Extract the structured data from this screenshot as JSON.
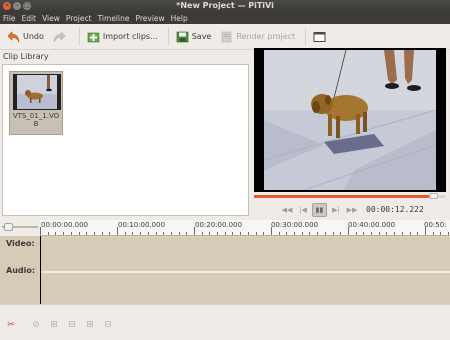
{
  "window": {
    "title": "*New Project — PiTiVi",
    "close_glyph": "×",
    "min_glyph": "–",
    "max_glyph": "□"
  },
  "menu": [
    "File",
    "Edit",
    "View",
    "Project",
    "Timeline",
    "Preview",
    "Help"
  ],
  "toolbar": {
    "undo_label": "Undo",
    "redo_icon": "redo-icon",
    "import_label": "Import clips...",
    "save_label": "Save",
    "render_label": "Render project",
    "fullscreen_icon": "fullscreen-icon"
  },
  "library": {
    "label": "Clip Library",
    "clips": [
      {
        "name": "VTS_01_1.VOB"
      }
    ]
  },
  "viewer": {
    "progress": 0.93,
    "timecode": "00:00:12.222",
    "transport_icons": [
      "goto-start-icon",
      "rewind-icon",
      "play-pause-icon",
      "forward-icon",
      "goto-end-icon"
    ]
  },
  "timeline": {
    "ruler_labels": [
      "00:00:00.000",
      "00:10:00.000",
      "00:20:00.000",
      "00:30:00.000",
      "00:40:00.000",
      "00:50:"
    ],
    "tracks": [
      {
        "label": "Video:"
      },
      {
        "label": "Audio:"
      }
    ]
  },
  "bottom_toolbar": {
    "icons": [
      "delete-clip-icon",
      "unlink-icon",
      "link-icon",
      "ungroup-icon",
      "group-icon",
      "align-icon"
    ]
  },
  "colors": {
    "accent": "#e35e2c",
    "track_bg": "#d5cbb6",
    "titlebar": "#3c3b37"
  }
}
